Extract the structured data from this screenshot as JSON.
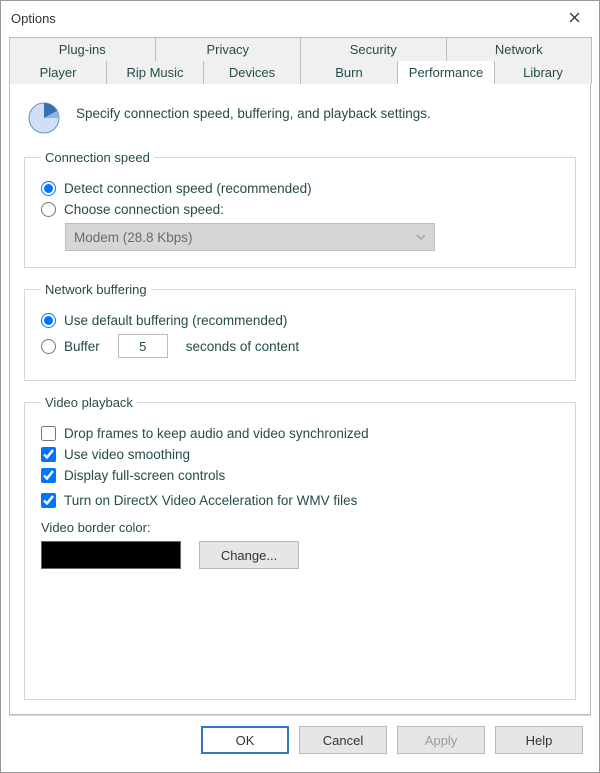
{
  "window": {
    "title": "Options"
  },
  "tabs_row1": [
    "Plug-ins",
    "Privacy",
    "Security",
    "Network"
  ],
  "tabs_row2": [
    "Player",
    "Rip Music",
    "Devices",
    "Burn",
    "Performance",
    "Library"
  ],
  "active_tab": "Performance",
  "intro": "Specify connection speed, buffering, and playback settings.",
  "groups": {
    "connection": {
      "legend": "Connection speed",
      "opt_detect": "Detect connection speed (recommended)",
      "opt_choose": "Choose connection speed:",
      "select_value": "Modem (28.8 Kbps)"
    },
    "buffering": {
      "legend": "Network buffering",
      "opt_default": "Use default buffering (recommended)",
      "opt_buffer_prefix": "Buffer",
      "buffer_value": "5",
      "opt_buffer_suffix": "seconds of content"
    },
    "video": {
      "legend": "Video playback",
      "chk_dropframes": "Drop frames to keep audio and video synchronized",
      "chk_smoothing": "Use video smoothing",
      "chk_fullscreen": "Display full-screen controls",
      "chk_directx": "Turn on DirectX Video Acceleration for WMV files",
      "border_label": "Video border color:",
      "change_btn": "Change..."
    }
  },
  "buttons": {
    "ok": "OK",
    "cancel": "Cancel",
    "apply": "Apply",
    "help": "Help"
  }
}
